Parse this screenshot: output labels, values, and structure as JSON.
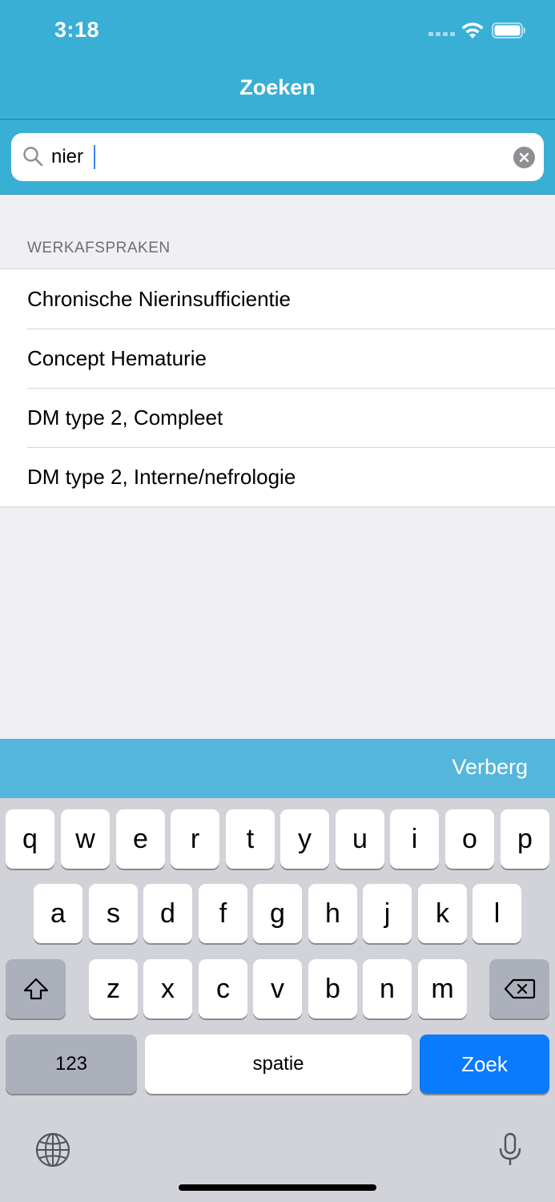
{
  "status_bar": {
    "time": "3:18"
  },
  "nav": {
    "title": "Zoeken"
  },
  "search": {
    "value": "nier",
    "placeholder": ""
  },
  "section": {
    "header": "WERKAFSPRAKEN"
  },
  "results": [
    {
      "label": "Chronische Nierinsufficientie"
    },
    {
      "label": "Concept Hematurie"
    },
    {
      "label": "DM type 2, Compleet"
    },
    {
      "label": "DM type 2, Interne/nefrologie"
    }
  ],
  "accessory": {
    "hide_label": "Verberg"
  },
  "keyboard": {
    "row1": [
      "q",
      "w",
      "e",
      "r",
      "t",
      "y",
      "u",
      "i",
      "o",
      "p"
    ],
    "row2": [
      "a",
      "s",
      "d",
      "f",
      "g",
      "h",
      "j",
      "k",
      "l"
    ],
    "row3": [
      "z",
      "x",
      "c",
      "v",
      "b",
      "n",
      "m"
    ],
    "numbers_label": "123",
    "space_label": "spatie",
    "go_label": "Zoek",
    "icons": {
      "shift": "shift-icon",
      "backspace": "backspace-icon",
      "globe": "globe-icon",
      "mic": "microphone-icon"
    }
  },
  "colors": {
    "header_bg": "#3aafd6",
    "accessory_bg": "#55b6db",
    "go_key": "#0a7aff"
  }
}
